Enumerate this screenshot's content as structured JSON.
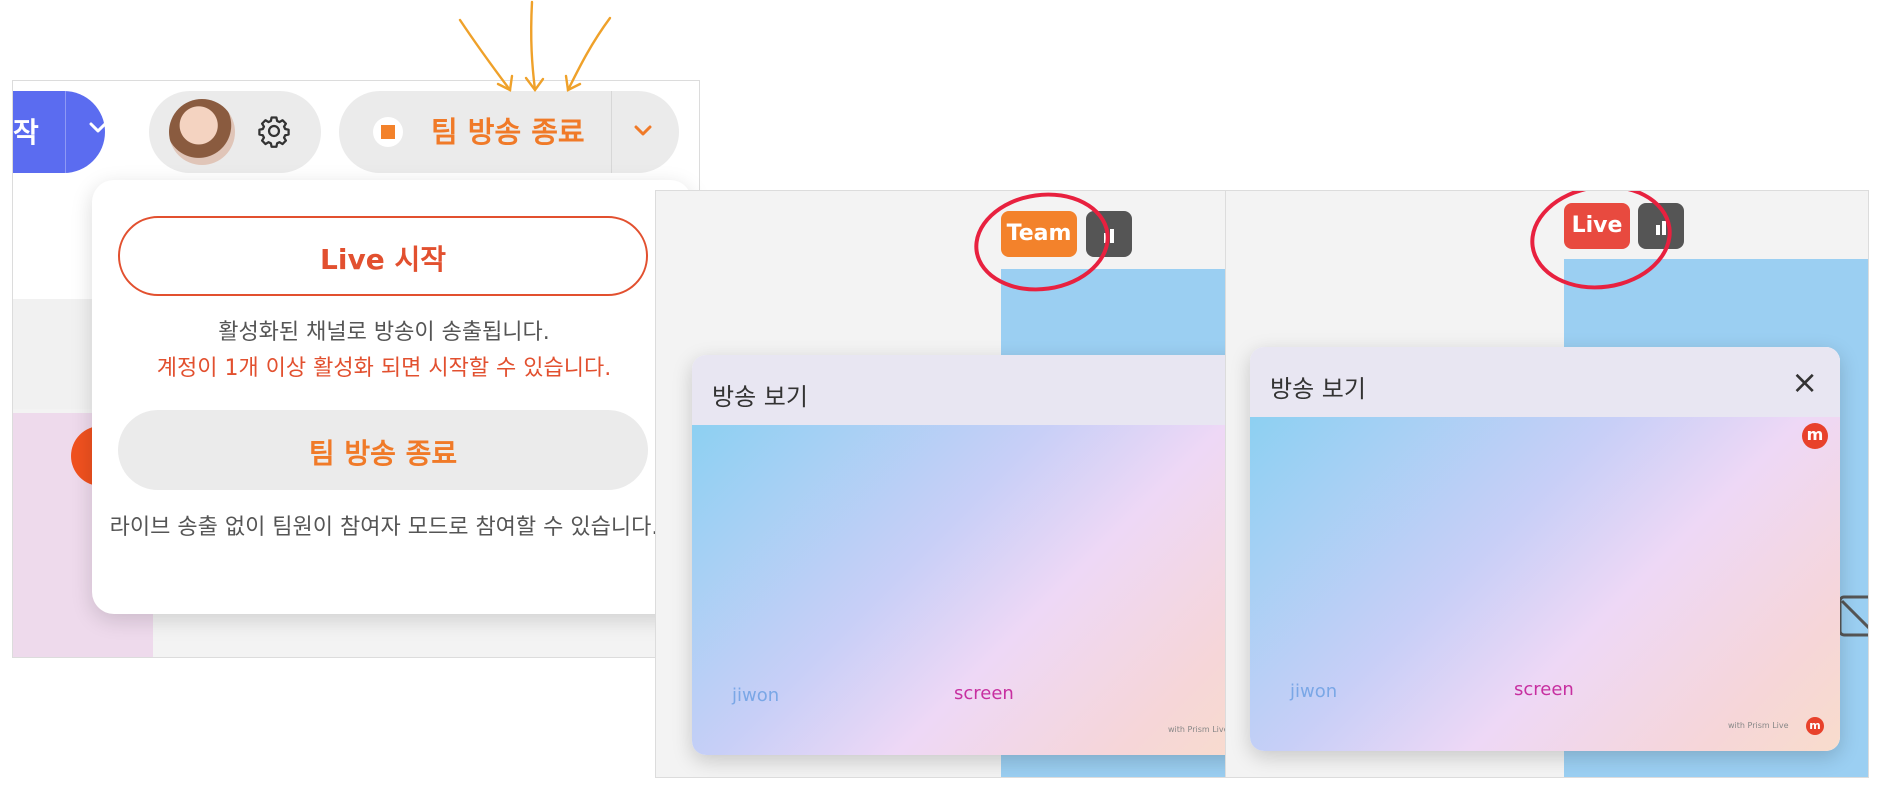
{
  "left": {
    "start_button_fragment": "작",
    "end_broadcast_button": "팀 방송 종료",
    "dropdown": {
      "live_start_button": "Live 시작",
      "live_desc": "활성화된 채널로 방송이 송출됩니다.",
      "live_warning": "계정이 1개 이상 활성화 되면 시작할 수 있습니다.",
      "team_end_button": "팀 방송 종료",
      "team_end_desc": "라이브 송출 없이 팀원이 참여자 모드로 참여할 수 있습니다."
    }
  },
  "middle": {
    "badge": "Team",
    "viewer_title": "방송 보기",
    "label_1": "jiwon",
    "label_2": "screen",
    "watermark": "with Prism Live"
  },
  "right": {
    "badge": "Live",
    "viewer_title": "방송 보기",
    "close_icon": "×",
    "logo_letter": "m",
    "label_1": "jiwon",
    "label_2": "screen",
    "watermark": "with Prism Live"
  },
  "colors": {
    "accent_orange": "#f07a28",
    "live_red": "#e2502f",
    "start_blue": "#5b6cf0",
    "annotation_red": "#e8213f"
  }
}
